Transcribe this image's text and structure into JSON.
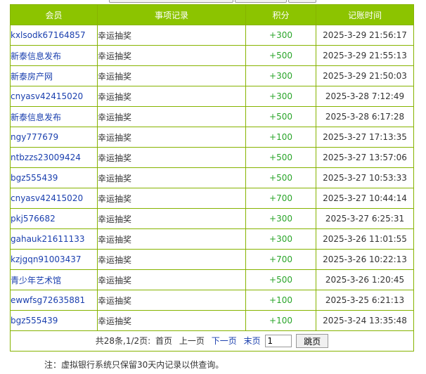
{
  "header": {
    "col_member": "会员",
    "col_item": "事项记录",
    "col_points": "积分",
    "col_time": "记账时间"
  },
  "rows": [
    {
      "member": "kxlsodk67164857",
      "item": "幸运抽奖",
      "points": "+300",
      "time": "2025-3-29 21:56:17"
    },
    {
      "member": "新泰信息发布",
      "item": "幸运抽奖",
      "points": "+500",
      "time": "2025-3-29 21:55:13"
    },
    {
      "member": "新泰房产网",
      "item": "幸运抽奖",
      "points": "+300",
      "time": "2025-3-29 21:50:03"
    },
    {
      "member": "cnyasv42415020",
      "item": "幸运抽奖",
      "points": "+300",
      "time": "2025-3-28 7:12:49"
    },
    {
      "member": "新泰信息发布",
      "item": "幸运抽奖",
      "points": "+500",
      "time": "2025-3-28 6:17:28"
    },
    {
      "member": "ngy777679",
      "item": "幸运抽奖",
      "points": "+100",
      "time": "2025-3-27 17:13:35"
    },
    {
      "member": "ntbzzs23009424",
      "item": "幸运抽奖",
      "points": "+500",
      "time": "2025-3-27 13:57:06"
    },
    {
      "member": "bgz555439",
      "item": "幸运抽奖",
      "points": "+500",
      "time": "2025-3-27 10:53:33"
    },
    {
      "member": "cnyasv42415020",
      "item": "幸运抽奖",
      "points": "+700",
      "time": "2025-3-27 10:44:14"
    },
    {
      "member": "pkj576682",
      "item": "幸运抽奖",
      "points": "+300",
      "time": "2025-3-27 6:25:31"
    },
    {
      "member": "gahauk21611133",
      "item": "幸运抽奖",
      "points": "+300",
      "time": "2025-3-26 11:01:55"
    },
    {
      "member": "kzjgqn91003437",
      "item": "幸运抽奖",
      "points": "+700",
      "time": "2025-3-26 10:22:13"
    },
    {
      "member": "青少年艺术馆",
      "item": "幸运抽奖",
      "points": "+500",
      "time": "2025-3-26 1:20:45"
    },
    {
      "member": "ewwfsg72635881",
      "item": "幸运抽奖",
      "points": "+100",
      "time": "2025-3-25 6:21:13"
    },
    {
      "member": "bgz555439",
      "item": "幸运抽奖",
      "points": "+100",
      "time": "2025-3-24 13:35:48"
    }
  ],
  "pager": {
    "summary": "共28条,1/2页:",
    "first": "首页",
    "prev": "上一页",
    "next": "下一页",
    "last": "末页",
    "page_value": "1",
    "jump_label": "跳页"
  },
  "note": "注：虚拟银行系统只保留30天内记录以供查询。",
  "colors": {
    "header_bg": "#8cc400",
    "border": "#86b300",
    "link": "#1a3fae",
    "points": "#2aa52a"
  }
}
